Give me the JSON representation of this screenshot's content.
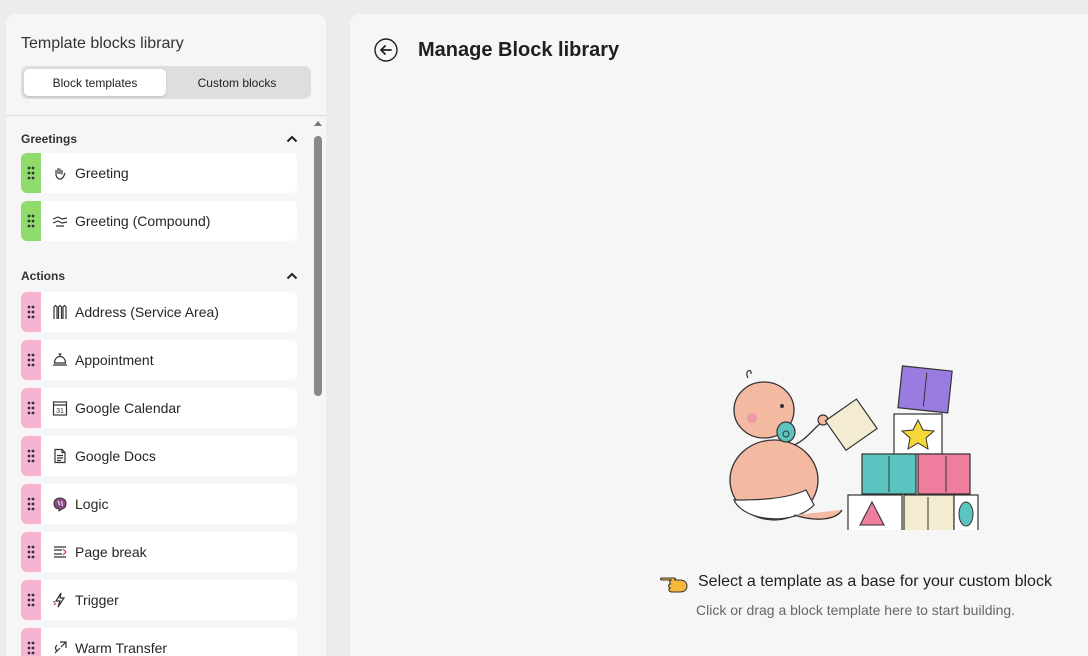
{
  "sidebar": {
    "title": "Template blocks library",
    "tabs": [
      {
        "label": "Block templates",
        "active": true
      },
      {
        "label": "Custom blocks",
        "active": false
      }
    ],
    "sections": [
      {
        "label": "Greetings",
        "items": [
          {
            "label": "Greeting",
            "icon": "waving-hand-icon"
          },
          {
            "label": "Greeting (Compound)",
            "icon": "handshake-icon"
          }
        ]
      },
      {
        "label": "Actions",
        "items": [
          {
            "label": "Address (Service Area)",
            "icon": "fence-icon"
          },
          {
            "label": "Appointment",
            "icon": "service-bell-icon"
          },
          {
            "label": "Google Calendar",
            "icon": "calendar-icon",
            "icon_text": "31"
          },
          {
            "label": "Google Docs",
            "icon": "document-icon"
          },
          {
            "label": "Logic",
            "icon": "brain-icon"
          },
          {
            "label": "Page break",
            "icon": "page-break-icon"
          },
          {
            "label": "Trigger",
            "icon": "lightning-icon"
          },
          {
            "label": "Warm Transfer",
            "icon": "phone-transfer-icon"
          }
        ]
      }
    ]
  },
  "main": {
    "title": "Manage Block library",
    "empty_state": {
      "title": "Select a template as a base for your custom block",
      "subtitle": "Click or drag a block template here to start building."
    }
  },
  "colors": {
    "greeting_handle": "#8fdc6c",
    "action_handle": "#f6b3d2",
    "panel_bg": "#f6f6f6",
    "page_bg": "#ececec"
  }
}
